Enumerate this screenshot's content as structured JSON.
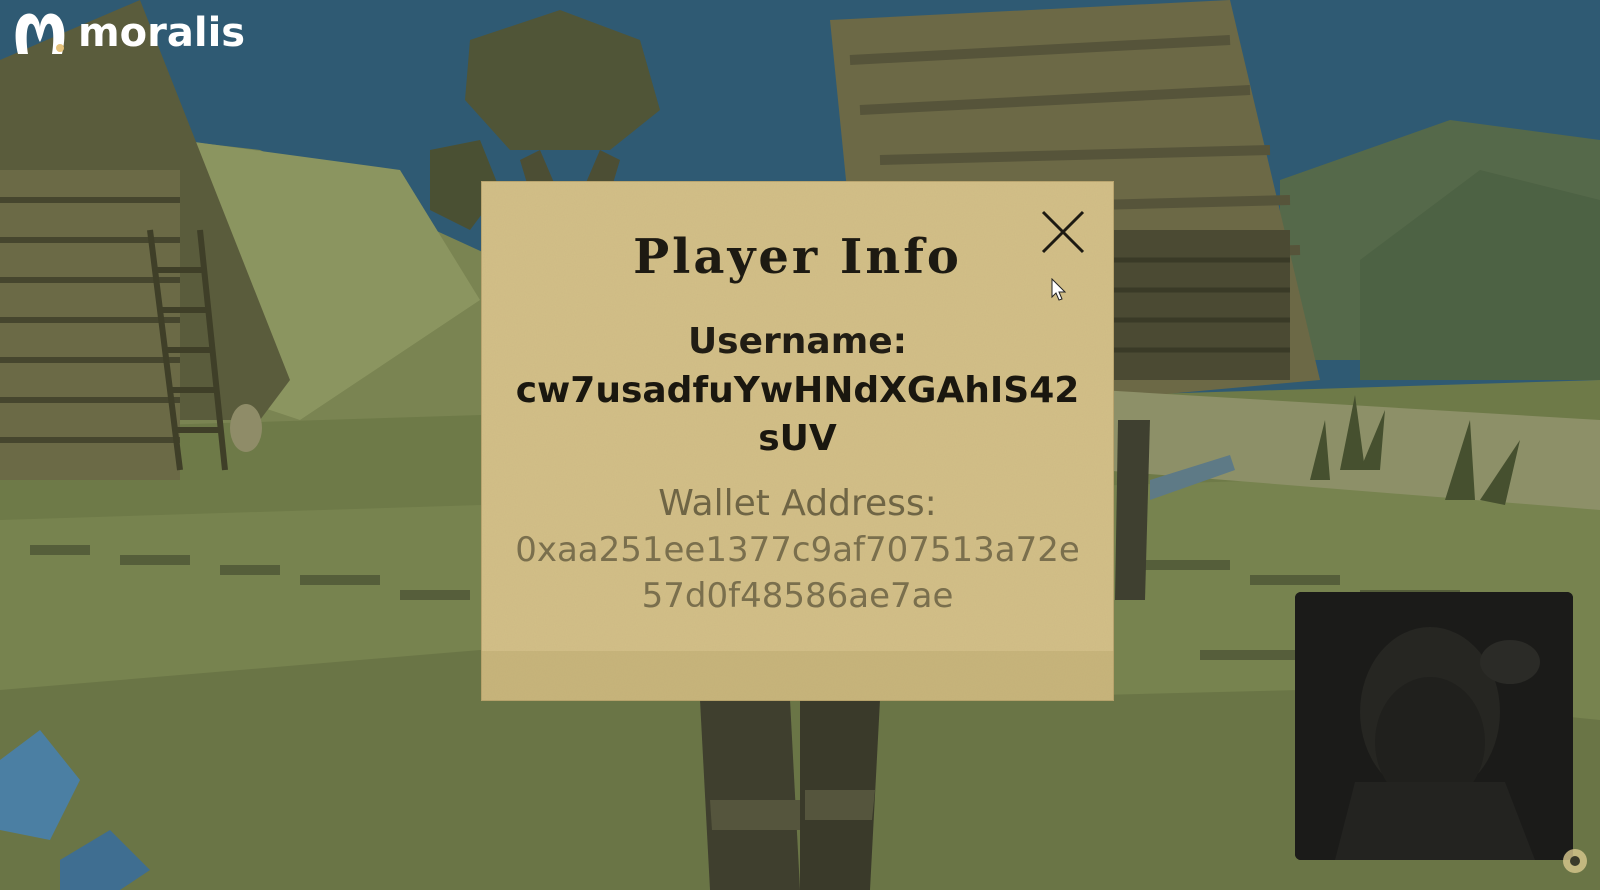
{
  "app": {
    "brand": "moralis"
  },
  "dialog": {
    "title": "Player Info",
    "close_icon": "close-icon",
    "username_label": "Username:",
    "username_value": "cw7usadfuYwHNdXGAhIS42sUV",
    "wallet_label": "Wallet Address:",
    "wallet_value": "0xaa251ee1377c9af707513a72e57d0f48586ae7ae"
  },
  "colors": {
    "sky": "#2f5a73",
    "grass": "#6e7a48",
    "panel_bg": "#d3bf86",
    "title_text": "#1d1a12",
    "wallet_text": "#7a6f4d"
  },
  "overlay": {
    "webcam_icon": "webcam-feed",
    "corner_icon": "settings-icon"
  }
}
